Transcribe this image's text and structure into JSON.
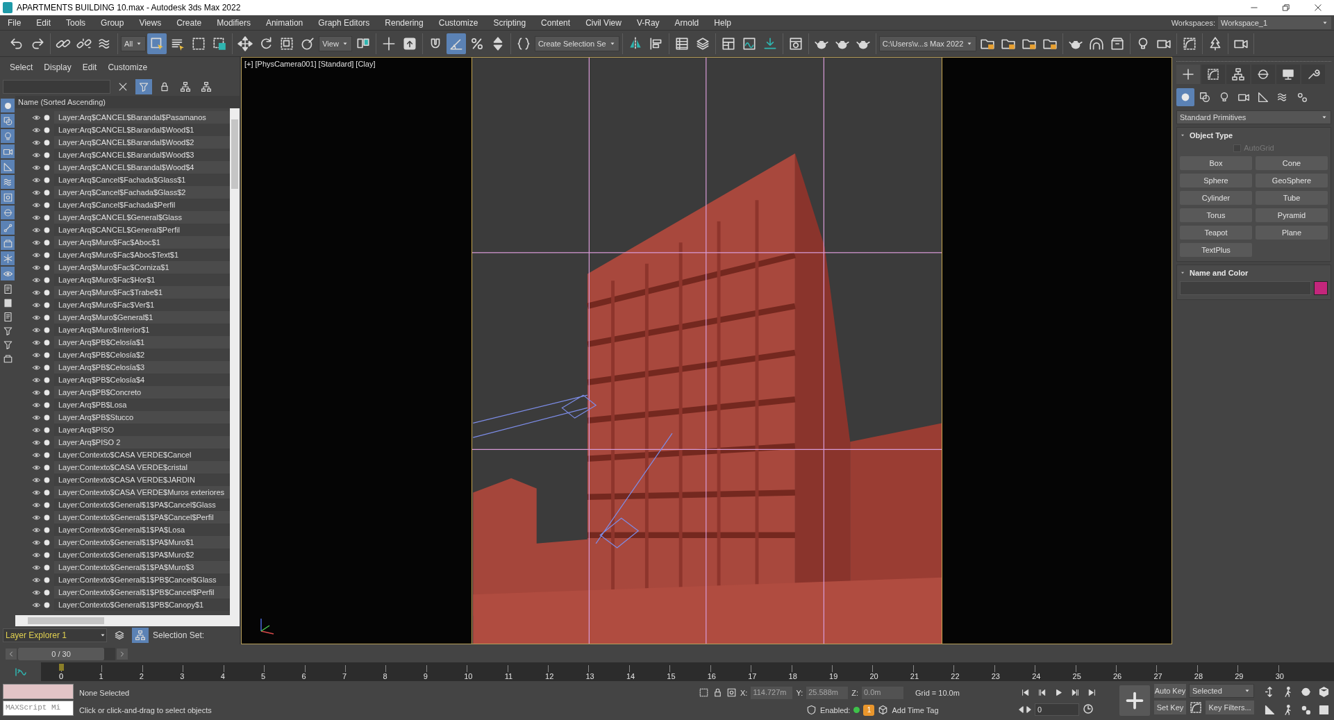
{
  "window": {
    "title": "APARTMENTS BUILDING 10.max - Autodesk 3ds Max 2022"
  },
  "menu": [
    "File",
    "Edit",
    "Tools",
    "Group",
    "Views",
    "Create",
    "Modifiers",
    "Animation",
    "Graph Editors",
    "Rendering",
    "Customize",
    "Scripting",
    "Content",
    "Civil View",
    "V-Ray",
    "Arnold",
    "Help"
  ],
  "workspaces": {
    "label": "Workspaces:",
    "value": "Workspace_1"
  },
  "toolbar": [
    [
      {
        "kind": "button",
        "selected": false
      },
      {
        "kind": "button",
        "selected": false
      }
    ],
    [
      {
        "kind": "button",
        "selected": false
      },
      {
        "kind": "button",
        "selected": false
      },
      {
        "kind": "button",
        "selected": false
      }
    ],
    [
      {
        "kind": "dropdown",
        "value": "All"
      },
      {
        "kind": "button",
        "selected": true
      },
      {
        "kind": "button",
        "selected": false
      },
      {
        "kind": "button",
        "selected": false
      },
      {
        "kind": "button",
        "selected": false
      }
    ],
    [
      {
        "kind": "button",
        "selected": false
      },
      {
        "kind": "button",
        "selected": false
      },
      {
        "kind": "button",
        "selected": false
      },
      {
        "kind": "button",
        "selected": false
      },
      {
        "kind": "dropdown",
        "value": "View"
      },
      {
        "kind": "button",
        "selected": false
      }
    ],
    [
      {
        "kind": "button",
        "selected": false
      },
      {
        "kind": "button",
        "selected": false
      }
    ],
    [
      {
        "kind": "button",
        "selected": false
      },
      {
        "kind": "button",
        "selected": true
      },
      {
        "kind": "button",
        "selected": false
      },
      {
        "kind": "button",
        "selected": false
      }
    ],
    [
      {
        "kind": "button",
        "selected": false
      },
      {
        "kind": "dropdown",
        "value": "Create Selection Se"
      }
    ],
    [
      {
        "kind": "button",
        "selected": false
      },
      {
        "kind": "button",
        "selected": false
      }
    ],
    [
      {
        "kind": "button",
        "selected": false
      },
      {
        "kind": "button",
        "selected": false
      }
    ],
    [
      {
        "kind": "button",
        "selected": false
      },
      {
        "kind": "button",
        "selected": false
      },
      {
        "kind": "button",
        "selected": false
      }
    ],
    [
      {
        "kind": "button",
        "selected": false
      }
    ],
    [
      {
        "kind": "button",
        "selected": false
      },
      {
        "kind": "button",
        "selected": false
      },
      {
        "kind": "button",
        "selected": false
      }
    ],
    [
      {
        "kind": "dropdown",
        "value": "C:\\Users\\v...s Max 2022"
      },
      {
        "kind": "button",
        "selected": false
      },
      {
        "kind": "button",
        "selected": false
      },
      {
        "kind": "button",
        "selected": false
      },
      {
        "kind": "button",
        "selected": false
      }
    ],
    [
      {
        "kind": "button",
        "selected": false
      },
      {
        "kind": "button",
        "selected": false
      },
      {
        "kind": "button",
        "selected": false
      }
    ],
    [
      {
        "kind": "button",
        "selected": false
      },
      {
        "kind": "button",
        "selected": false
      }
    ],
    [
      {
        "kind": "button",
        "selected": false
      }
    ],
    [
      {
        "kind": "button",
        "selected": false
      }
    ],
    [
      {
        "kind": "button",
        "selected": false
      }
    ]
  ],
  "scene_explorer": {
    "menu": [
      "Select",
      "Display",
      "Edit",
      "Customize"
    ],
    "filter_toggle": {
      "selected": true
    },
    "filters": [
      {
        "on": true
      },
      {
        "on": true
      },
      {
        "on": true
      },
      {
        "on": true
      },
      {
        "on": true
      },
      {
        "on": true
      },
      {
        "on": true
      },
      {
        "on": true
      },
      {
        "on": true
      },
      {
        "on": true
      },
      {
        "on": true
      },
      {
        "on": true
      }
    ],
    "column": "Name (Sorted Ascending)",
    "rows": [
      "Layer:Arq$CANCEL$Barandal$Pasamanos",
      "Layer:Arq$CANCEL$Barandal$Wood$1",
      "Layer:Arq$CANCEL$Barandal$Wood$2",
      "Layer:Arq$CANCEL$Barandal$Wood$3",
      "Layer:Arq$CANCEL$Barandal$Wood$4",
      "Layer:Arq$Cancel$Fachada$Glass$1",
      "Layer:Arq$Cancel$Fachada$Glass$2",
      "Layer:Arq$Cancel$Fachada$Perfil",
      "Layer:Arq$CANCEL$General$Glass",
      "Layer:Arq$CANCEL$General$Perfil",
      "Layer:Arq$Muro$Fac$Aboc$1",
      "Layer:Arq$Muro$Fac$Aboc$Text$1",
      "Layer:Arq$Muro$Fac$Corniza$1",
      "Layer:Arq$Muro$Fac$Hor$1",
      "Layer:Arq$Muro$Fac$Trabe$1",
      "Layer:Arq$Muro$Fac$Ver$1",
      "Layer:Arq$Muro$General$1",
      "Layer:Arq$Muro$Interior$1",
      "Layer:Arq$PB$Celosía$1",
      "Layer:Arq$PB$Celosía$2",
      "Layer:Arq$PB$Celosía$3",
      "Layer:Arq$PB$Celosía$4",
      "Layer:Arq$PB$Concreto",
      "Layer:Arq$PB$Losa",
      "Layer:Arq$PB$Stucco",
      "Layer:Arq$PISO",
      "Layer:Arq$PISO 2",
      "Layer:Contexto$CASA VERDE$Cancel",
      "Layer:Contexto$CASA VERDE$cristal",
      "Layer:Contexto$CASA VERDE$JARDIN",
      "Layer:Contexto$CASA VERDE$Muros exteriores",
      "Layer:Contexto$General$1$PA$Cancel$Glass",
      "Layer:Contexto$General$1$PA$Cancel$Perfil",
      "Layer:Contexto$General$1$PA$Losa",
      "Layer:Contexto$General$1$PA$Muro$1",
      "Layer:Contexto$General$1$PA$Muro$2",
      "Layer:Contexto$General$1$PA$Muro$3",
      "Layer:Contexto$General$1$PB$Cancel$Glass",
      "Layer:Contexto$General$1$PB$Cancel$Perfil",
      "Layer:Contexto$General$1$PB$Canopy$1"
    ],
    "explorer": "Layer Explorer 1",
    "view_toggles": [
      {
        "selected": false
      },
      {
        "selected": true
      }
    ],
    "selection_set": "Selection Set:"
  },
  "viewport": {
    "labels": [
      "[+]",
      "[PhysCamera001]",
      "[Standard]",
      "[Clay]"
    ],
    "active": true
  },
  "command_panel": {
    "tabs": [
      {
        "selected": true
      },
      {
        "selected": false
      },
      {
        "selected": false
      },
      {
        "selected": false
      },
      {
        "selected": false
      },
      {
        "selected": false
      }
    ],
    "categories": [
      {
        "selected": true
      },
      {
        "selected": false
      },
      {
        "selected": false
      },
      {
        "selected": false
      },
      {
        "selected": false
      },
      {
        "selected": false
      },
      {
        "selected": false
      }
    ],
    "dropdown": "Standard Primitives",
    "object_type": {
      "title": "Object Type",
      "expanded": true,
      "autogrid": {
        "label": "AutoGrid",
        "checked": false,
        "disabled": true
      },
      "buttons": [
        "Box",
        "Cone",
        "Sphere",
        "GeoSphere",
        "Cylinder",
        "Tube",
        "Torus",
        "Pyramid",
        "Teapot",
        "Plane",
        "TextPlus"
      ]
    },
    "name_and_color": {
      "title": "Name and Color",
      "expanded": true,
      "color": "#c4267c"
    }
  },
  "timeline": {
    "slider": "0 / 30",
    "level": 0,
    "ticks": [
      "0",
      "1",
      "2",
      "3",
      "4",
      "5",
      "6",
      "7",
      "8",
      "9",
      "10",
      "11",
      "12",
      "13",
      "14",
      "15",
      "16",
      "17",
      "18",
      "19",
      "20",
      "21",
      "22",
      "23",
      "24",
      "25",
      "26",
      "27",
      "28",
      "29",
      "30"
    ]
  },
  "status": {
    "listener": "MAXScript Mi",
    "selection": "None Selected",
    "prompt": "Click or click-and-drag to select objects",
    "coords": {
      "disabled": true,
      "fields": [
        {
          "label": "X:",
          "value": "114.727m"
        },
        {
          "label": "Y:",
          "value": "25.588m"
        },
        {
          "label": "Z:",
          "value": "0.0m"
        }
      ]
    },
    "grid": "Grid = 10.0m",
    "enabled": {
      "label": "Enabled:",
      "on": true
    },
    "badge": "1",
    "time_tag": "Add Time Tag",
    "frame": "0",
    "auto_key": {
      "label": "Auto Key",
      "on": false
    },
    "set_key": "Set Key",
    "key_mode": "Selected",
    "key_filters": "Key Filters..."
  }
}
